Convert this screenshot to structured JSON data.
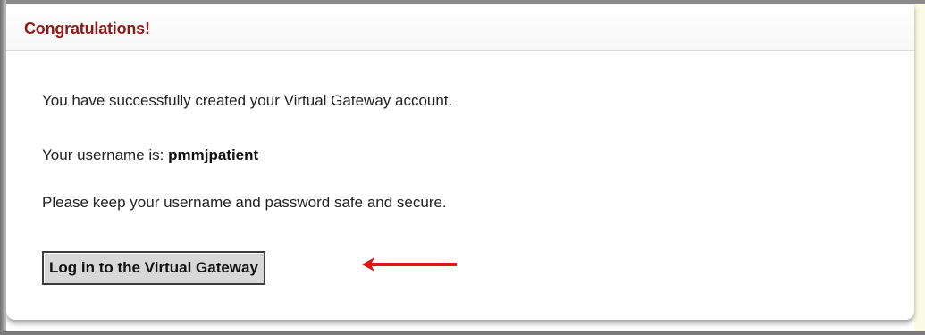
{
  "panel": {
    "title": "Congratulations!"
  },
  "messages": {
    "created": "You have successfully created your Virtual Gateway account.",
    "username_label": "Your username is: ",
    "username_value": "pmmjpatient",
    "keep_safe": "Please keep your username and password safe and secure."
  },
  "actions": {
    "login_label": "Log in to the Virtual Gateway"
  },
  "annotation": {
    "icon": "red-arrow-left",
    "color": "#e01515"
  },
  "colors": {
    "title": "#8b1a1a",
    "right_strip": "#fbfbe6"
  }
}
